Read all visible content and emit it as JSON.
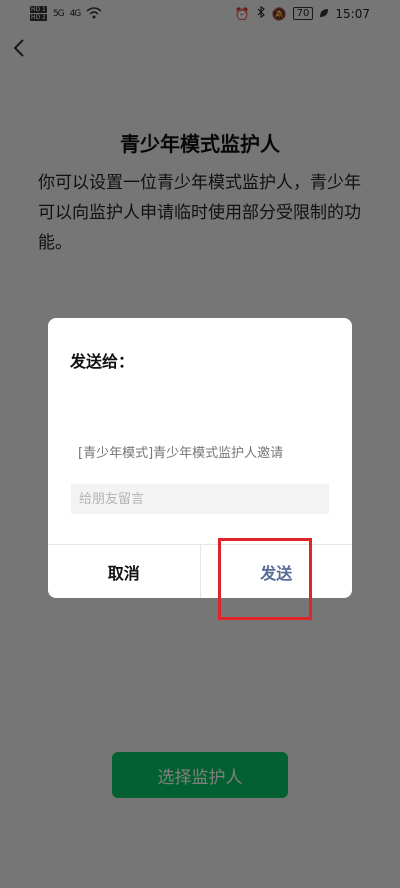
{
  "status_bar": {
    "hd1": "HD 1",
    "hd2": "HD 2",
    "sig1": "5G",
    "sig2": "4G",
    "battery": "70",
    "time": "15:07"
  },
  "page": {
    "title": "青少年模式监护人",
    "description": "你可以设置一位青少年模式监护人，青少年可以向监护人申请临时使用部分受限制的功能。",
    "select_button": "选择监护人"
  },
  "dialog": {
    "title": "发送给：",
    "invite_text": "[青少年模式]青少年模式监护人邀请",
    "message_placeholder": "给朋友留言",
    "cancel": "取消",
    "send": "发送"
  },
  "colors": {
    "primary_green": "#07c160",
    "link_blue": "#576b95",
    "highlight_red": "#e0242b"
  },
  "icons": [
    "back-icon",
    "alarm-icon",
    "bluetooth-icon",
    "mute-icon",
    "wifi-icon",
    "leaf-icon"
  ]
}
